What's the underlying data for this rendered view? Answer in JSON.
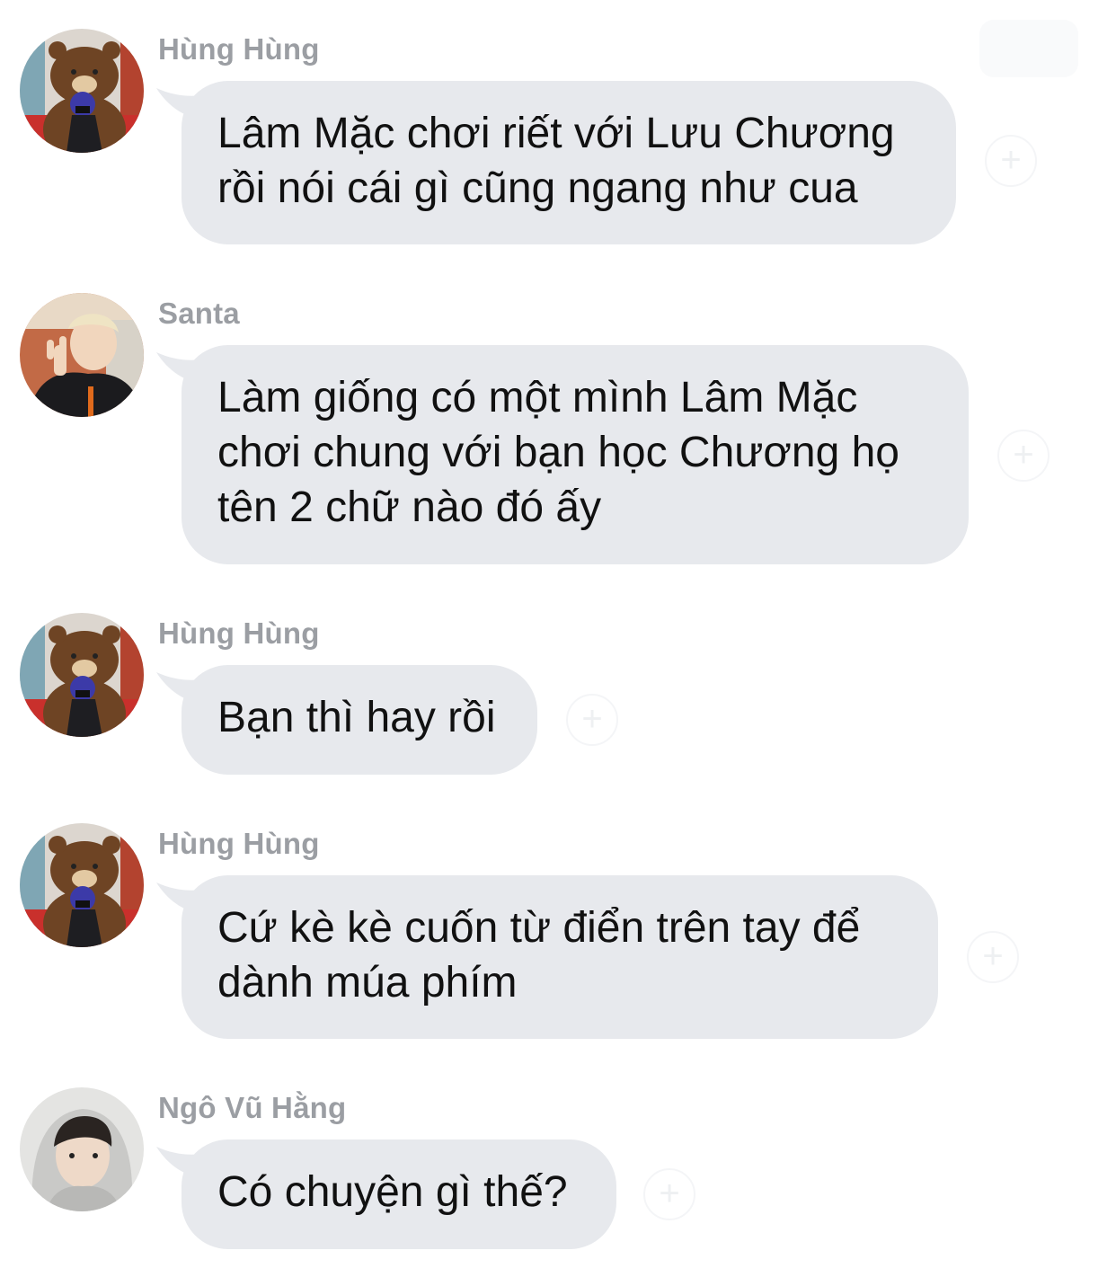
{
  "messages": [
    {
      "sender": "Hùng Hùng",
      "lines": [
        "Lâm Mặc chơi riết với Lưu Chương",
        "rồi nói cái gì cũng ngang như cua"
      ],
      "avatar": "teddy-bear-avatar"
    },
    {
      "sender": "Santa",
      "lines": [
        "Làm giống có một mình Lâm Mặc",
        "chơi chung với bạn học Chương họ",
        "tên 2 chữ nào đó ấy"
      ],
      "avatar": "peace-sign-avatar"
    },
    {
      "sender": "Hùng Hùng",
      "lines": [
        "Bạn thì hay rồi"
      ],
      "avatar": "teddy-bear-avatar"
    },
    {
      "sender": "Hùng Hùng",
      "lines": [
        "Cứ kè kè cuốn từ điển trên tay để",
        "dành múa phím"
      ],
      "avatar": "teddy-bear-avatar"
    },
    {
      "sender": "Ngô Vũ Hằng",
      "lines": [
        "Có chuyện gì thế?"
      ],
      "avatar": "hoodie-avatar"
    }
  ],
  "colors": {
    "bubble": "#e7e9ed",
    "sender_name": "#9b9ea3",
    "message_text": "#111111",
    "background": "#ffffff"
  },
  "icons": {
    "react": "add-reaction-icon"
  }
}
